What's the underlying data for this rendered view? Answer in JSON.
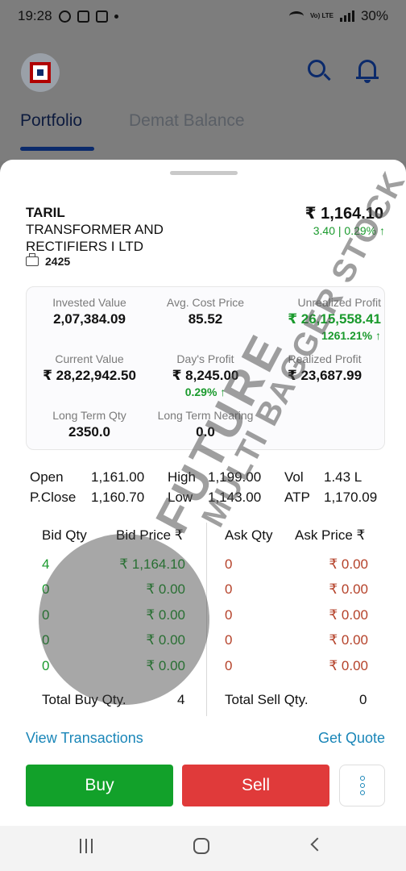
{
  "status_bar": {
    "time": "19:28",
    "battery": "30%",
    "network": "Vo) LTE"
  },
  "header": {
    "tabs": [
      {
        "label": "Portfolio"
      },
      {
        "label": "Demat Balance"
      }
    ]
  },
  "holding": {
    "symbol": "TARIL",
    "company_name": "TRANSFORMER AND RECTIFIERS I LTD",
    "quantity": "2425",
    "ltp": "₹ 1,164.10",
    "change": "3.40 | 0.29% ↑"
  },
  "summary": {
    "invested_value": {
      "label": "Invested Value",
      "value": "2,07,384.09"
    },
    "avg_cost_price": {
      "label": "Avg. Cost Price",
      "value": "85.52"
    },
    "unrealized_profit": {
      "label": "Unrealized Profit",
      "value": "₹ 26,15,558.41",
      "sub": "1261.21% ↑"
    },
    "current_value": {
      "label": "Current Value",
      "value": "₹ 28,22,942.50"
    },
    "days_profit": {
      "label": "Day's Profit",
      "value": "₹ 8,245.00",
      "sub": "0.29% ↑"
    },
    "realized_profit": {
      "label": "Realized Profit",
      "value": "₹ 23,687.99"
    },
    "long_term_qty": {
      "label": "Long Term Qty",
      "value": "2350.0"
    },
    "long_term_nearing": {
      "label": "Long Term Nearing",
      "value": "0.0"
    }
  },
  "quote": {
    "open": {
      "label": "Open",
      "value": "1,161.00"
    },
    "high": {
      "label": "High",
      "value": "1,199.00"
    },
    "vol": {
      "label": "Vol",
      "value": "1.43 L"
    },
    "pclose": {
      "label": "P.Close",
      "value": "1,160.70"
    },
    "low": {
      "label": "Low",
      "value": "1,143.00"
    },
    "atp": {
      "label": "ATP",
      "value": "1,170.09"
    }
  },
  "market_depth": {
    "headers": {
      "bid_qty": "Bid Qty",
      "bid_price": "Bid Price ₹",
      "ask_qty": "Ask Qty",
      "ask_price": "Ask Price ₹"
    },
    "rows": [
      {
        "bid_qty": "4",
        "bid_price": "₹ 1,164.10",
        "ask_qty": "0",
        "ask_price": "₹ 0.00"
      },
      {
        "bid_qty": "0",
        "bid_price": "₹ 0.00",
        "ask_qty": "0",
        "ask_price": "₹ 0.00"
      },
      {
        "bid_qty": "0",
        "bid_price": "₹ 0.00",
        "ask_qty": "0",
        "ask_price": "₹ 0.00"
      },
      {
        "bid_qty": "0",
        "bid_price": "₹ 0.00",
        "ask_qty": "0",
        "ask_price": "₹ 0.00"
      },
      {
        "bid_qty": "0",
        "bid_price": "₹ 0.00",
        "ask_qty": "0",
        "ask_price": "₹ 0.00"
      }
    ],
    "total_buy_label": "Total Buy Qty.",
    "total_buy": "4",
    "total_sell_label": "Total Sell Qty.",
    "total_sell": "0"
  },
  "links": {
    "view_transactions": "View Transactions",
    "get_quote": "Get Quote"
  },
  "actions": {
    "buy": "Buy",
    "sell": "Sell"
  },
  "watermark": {
    "line1": "FUTURE",
    "line2": "MULTI BAGGER STOCK"
  },
  "colors": {
    "buy": "#12a12a",
    "sell": "#e03a3a",
    "profit": "#1a9a2d",
    "link": "#1a86b8",
    "brand": "#0b2a6b"
  }
}
